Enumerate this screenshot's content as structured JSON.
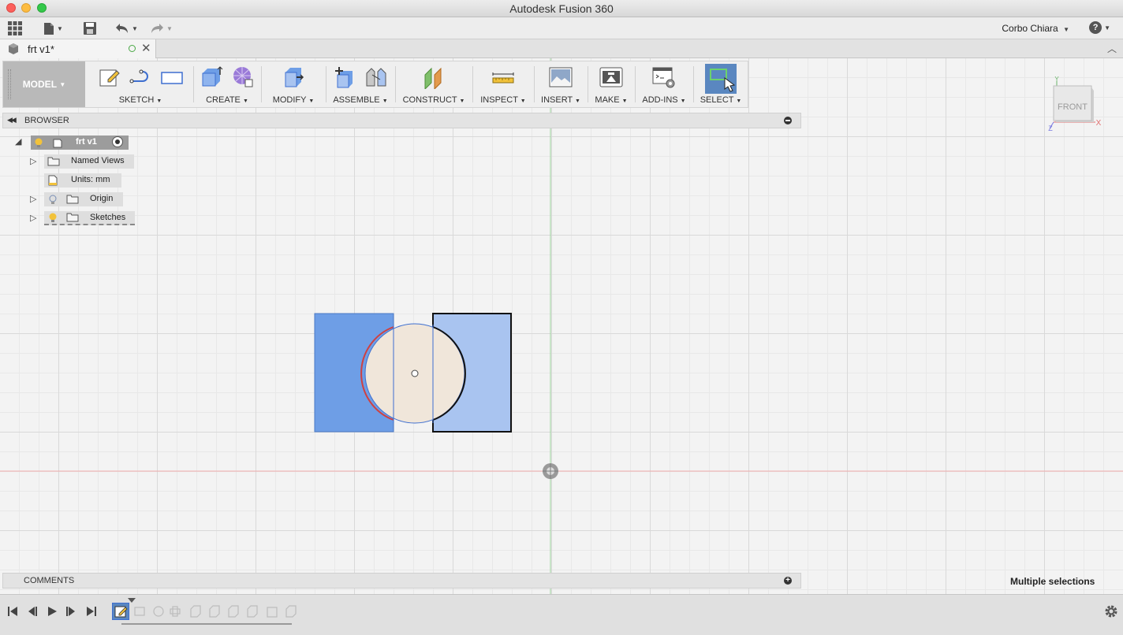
{
  "window": {
    "title": "Autodesk Fusion 360"
  },
  "qat": {
    "user": "Corbo Chiara",
    "help_icon": "question-icon"
  },
  "tab": {
    "label": "frt v1*"
  },
  "ribbon": {
    "workspace": "MODEL",
    "groups": [
      {
        "label": "SKETCH"
      },
      {
        "label": "CREATE"
      },
      {
        "label": "MODIFY"
      },
      {
        "label": "ASSEMBLE"
      },
      {
        "label": "CONSTRUCT"
      },
      {
        "label": "INSPECT"
      },
      {
        "label": "INSERT"
      },
      {
        "label": "MAKE"
      },
      {
        "label": "ADD-INS"
      },
      {
        "label": "SELECT"
      }
    ]
  },
  "browser": {
    "title": "BROWSER",
    "root": {
      "label": "frt v1"
    },
    "items": [
      {
        "label": "Named Views"
      },
      {
        "label": "Units: mm"
      },
      {
        "label": "Origin"
      },
      {
        "label": "Sketches"
      }
    ]
  },
  "viewcube": {
    "face": "FRONT",
    "axis_x": "X",
    "axis_y": "Y",
    "axis_z": "Z"
  },
  "comments": {
    "title": "COMMENTS"
  },
  "status": {
    "selection": "Multiple selections"
  },
  "colors": {
    "profile_dark": "#6e9ee6",
    "profile_light": "#a9c4f0",
    "circle_fill": "#f0e6da",
    "accent_select": "#5a87c0"
  }
}
